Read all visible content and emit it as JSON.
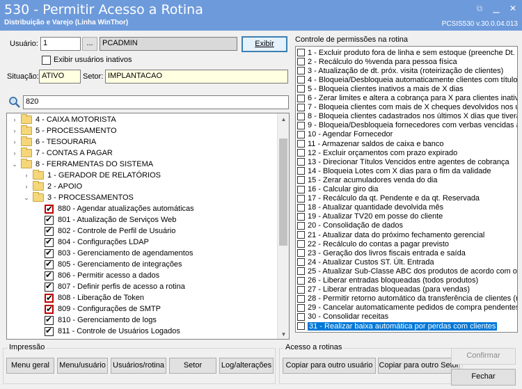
{
  "window": {
    "title": "530 - Permitir Acesso a Rotina",
    "subtitle": "Distribuição e Varejo (Linha WinThor)",
    "version": "PCSIS530  v.30.0.04.013"
  },
  "form": {
    "usuario_label": "Usuário:",
    "usuario_value": "1",
    "browse_label": "...",
    "usuario_name": "PCADMIN",
    "exibir_label": "Exibir",
    "inativos_label": "Exibir usuários inativos",
    "situacao_label": "Situação:",
    "situacao_value": "ATIVO",
    "setor_label": "Setor:",
    "setor_value": "IMPLANTACAO",
    "search_value": "820"
  },
  "tree": [
    {
      "label": "4 - CAIXA MOTORISTA",
      "level": 1,
      "type": "folder"
    },
    {
      "label": "5 - PROCESSAMENTO",
      "level": 1,
      "type": "folder"
    },
    {
      "label": "6 - TESOURARIA",
      "level": 1,
      "type": "folder"
    },
    {
      "label": "7 - CONTAS A PAGAR",
      "level": 1,
      "type": "folder"
    },
    {
      "label": "8 - FERRAMENTAS DO SISTEMA",
      "level": 1,
      "type": "folder",
      "expanded": true
    },
    {
      "label": "1 - GERADOR DE RELATÓRIOS",
      "level": 2,
      "type": "folder"
    },
    {
      "label": "2 - APOIO",
      "level": 2,
      "type": "folder"
    },
    {
      "label": "3 - PROCESSAMENTOS",
      "level": 2,
      "type": "folder",
      "expanded": true
    },
    {
      "label": "880 - Agendar atualizações automáticas",
      "level": 3,
      "type": "check",
      "red": true
    },
    {
      "label": "801 - Atualização de Serviços Web",
      "level": 3,
      "type": "check"
    },
    {
      "label": "802 - Controle de Perfil de Usuário",
      "level": 3,
      "type": "check"
    },
    {
      "label": "804 - Configurações LDAP",
      "level": 3,
      "type": "check"
    },
    {
      "label": "803 - Gerenciamento de agendamentos",
      "level": 3,
      "type": "check"
    },
    {
      "label": "805 - Gerenciamento de integrações",
      "level": 3,
      "type": "check"
    },
    {
      "label": "806 - Permitir acesso a dados",
      "level": 3,
      "type": "check"
    },
    {
      "label": "807 - Definir perfis de acesso a rotina",
      "level": 3,
      "type": "check"
    },
    {
      "label": "808 - Liberação de Token",
      "level": 3,
      "type": "check",
      "red": true
    },
    {
      "label": "809 - Configurações de SMTP",
      "level": 3,
      "type": "check",
      "red": true
    },
    {
      "label": "810 - Gerenciamento de logs",
      "level": 3,
      "type": "check"
    },
    {
      "label": "811 - Controle de Usuários Logados",
      "level": 3,
      "type": "check"
    }
  ],
  "permissions": {
    "title": "Controle de permissões na rotina",
    "items": [
      "1 - Excluir produto fora de linha e sem estoque (preenche Dt. E",
      "2 - Recálculo do %venda para pessoa física",
      "3 - Atualização de dt. próx. visita (roteirização de clientes)",
      "4 - Bloqueia/Desbloqueia automaticamente clientes com títulos",
      "5 - Bloqueia clientes inativos a mais de X dias",
      "6 - Zerar limites e altera a cobrança para X para clientes inativo",
      "7 - Bloqueia clientes com mais de X cheques devolvidos nos últi",
      "8 - Bloqueia clientes cadastrados nos últimos X dias que tiveram",
      "9 - Bloqueia/Desbloqueia fornecedores com verbas vencidas a",
      "10 - Agendar Fornecedor",
      "11 - Armazenar saldos de caixa e banco",
      "12 - Excluir orçamentos com prazo expirado",
      "13 - Direcionar Títulos Vencidos entre agentes de cobrança",
      "14 - Bloqueia Lotes com X dias para o fim da validade",
      "15 - Zerar acumuladores venda do dia",
      "16 - Calcular giro dia",
      "17 - Recálculo da qt. Pendente e da qt. Reservada",
      "18 - Atualizar quantidade devolvida mês",
      "19 - Atualizar TV20 em posse do cliente",
      "20 - Consolidação de dados",
      "21 - Atualizar data do próximo fechamento gerencial",
      "22 - Recálculo do contas a pagar previsto",
      "23 - Geração dos livros fiscais entrada e saída",
      "24 - Atualizar Custos ST. Últ. Entrada",
      "25 - Atualizar Sub-Classe ABC dos produtos de acordo com os p",
      "26 - Liberar entradas bloqueadas (todos produtos)",
      "27 - Liberar entradas bloqueadas (para vendas)",
      "28 - Permitir retorno automático da transferência de clientes (r",
      "29 - Cancelar automaticamente pedidos de compra pendentes",
      "30 - Consolidar receitas",
      "31 - Realizar baixa automática por perdas com clientes"
    ],
    "selected_index": 30
  },
  "impressao": {
    "title": "Impressão",
    "buttons": [
      "Menu geral",
      "Menu/usuário",
      "Usuários/rotina",
      "Setor",
      "Log/alterações"
    ]
  },
  "acesso": {
    "title": "Acesso a rotinas",
    "copy_user": "Copiar para outro usuário",
    "copy_setor": "Copiar para outro Setor"
  },
  "actions": {
    "confirmar": "Confirmar",
    "fechar": "Fechar"
  }
}
